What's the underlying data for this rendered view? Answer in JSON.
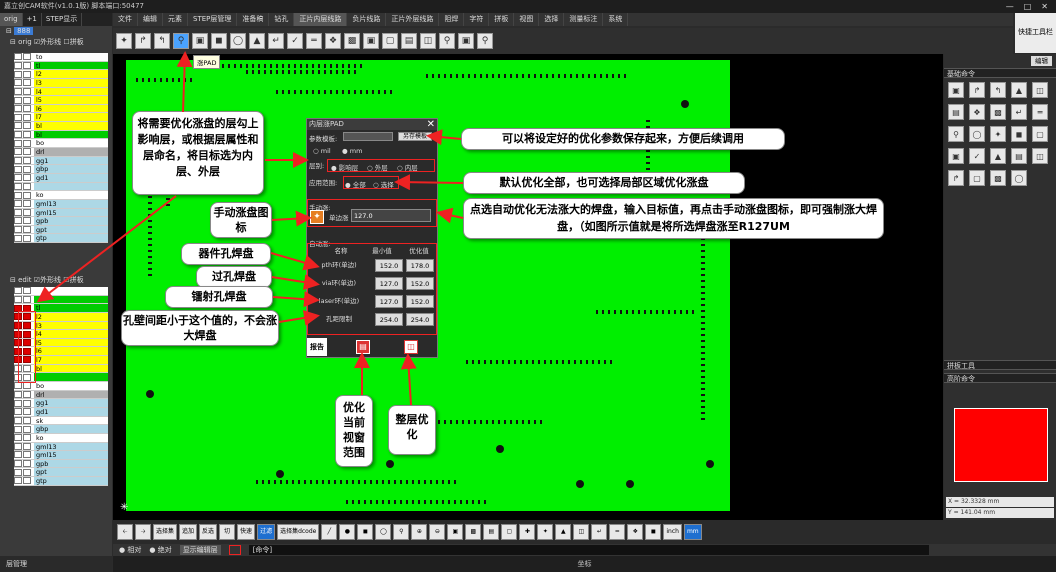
{
  "window": {
    "title": "嘉立创CAM软件(v1.0.1版) 脚本端口:50477"
  },
  "left": {
    "tabs": [
      "orig",
      "+1",
      "STEP显示"
    ],
    "job": "888",
    "orig_group": {
      "name": "orig",
      "opt1": "外形线",
      "opt2": "拼板"
    },
    "edit_group": {
      "name": "edit",
      "opt1": "外形线",
      "opt2": "拼板"
    },
    "orig_layers": [
      {
        "name": "to",
        "color": "#ffffff"
      },
      {
        "name": "tl",
        "color": "#00cc00"
      },
      {
        "name": "l2",
        "color": "#ffff00"
      },
      {
        "name": "l3",
        "color": "#ffff00"
      },
      {
        "name": "l4",
        "color": "#ffff00"
      },
      {
        "name": "l5",
        "color": "#ffff00"
      },
      {
        "name": "l6",
        "color": "#ffff00"
      },
      {
        "name": "l7",
        "color": "#ffff00"
      },
      {
        "name": "bl",
        "color": "#ffff00"
      },
      {
        "name": "bl",
        "color": "#00cc00"
      },
      {
        "name": "bo",
        "color": "#ffffff"
      },
      {
        "name": "drl",
        "color": "#b0b0b0"
      },
      {
        "name": "gg1",
        "color": "#add8e6"
      },
      {
        "name": "gbp",
        "color": "#add8e6"
      },
      {
        "name": "gd1",
        "color": "#add8e6"
      },
      {
        "name": "",
        "color": "#add8e6"
      },
      {
        "name": "ko",
        "color": "#ffffff"
      },
      {
        "name": "gml13",
        "color": "#add8e6"
      },
      {
        "name": "gml15",
        "color": "#add8e6"
      },
      {
        "name": "gpb",
        "color": "#add8e6"
      },
      {
        "name": "gpt",
        "color": "#add8e6"
      },
      {
        "name": "gtp",
        "color": "#add8e6"
      }
    ],
    "edit_layers": [
      {
        "name": "",
        "color": "#ffffff",
        "red": false
      },
      {
        "name": "",
        "color": "#00cc00",
        "red": false
      },
      {
        "name": "tl",
        "color": "#00cc00",
        "red": true
      },
      {
        "name": "l2",
        "color": "#ffff00",
        "red": true
      },
      {
        "name": "l3",
        "color": "#ffff00",
        "red": true
      },
      {
        "name": "l4",
        "color": "#ffff00",
        "red": true
      },
      {
        "name": "l5",
        "color": "#ffff00",
        "red": true
      },
      {
        "name": "l6",
        "color": "#ffff00",
        "red": true
      },
      {
        "name": "l7",
        "color": "#ffff00",
        "red": true
      },
      {
        "name": "bl",
        "color": "#ffff00",
        "red": false
      },
      {
        "name": "",
        "color": "#00cc00",
        "red": false
      },
      {
        "name": "bo",
        "color": "#ffffff",
        "red": false
      },
      {
        "name": "drl",
        "color": "#b0b0b0",
        "red": false
      },
      {
        "name": "gg1",
        "color": "#add8e6",
        "red": false
      },
      {
        "name": "gd1",
        "color": "#add8e6",
        "red": false
      },
      {
        "name": "sk",
        "color": "#ffffff",
        "red": false
      },
      {
        "name": "gbp",
        "color": "#add8e6",
        "red": false
      },
      {
        "name": "ko",
        "color": "#ffffff",
        "red": false
      },
      {
        "name": "gml13",
        "color": "#add8e6",
        "red": false
      },
      {
        "name": "gml15",
        "color": "#add8e6",
        "red": false
      },
      {
        "name": "gpb",
        "color": "#add8e6",
        "red": false
      },
      {
        "name": "gpt",
        "color": "#add8e6",
        "red": false
      },
      {
        "name": "gtp",
        "color": "#add8e6",
        "red": false
      }
    ],
    "footer": "层管理"
  },
  "menu": [
    "文件",
    "编辑",
    "元素",
    "STEP层管理",
    "准备稿",
    "钻孔",
    "正片内层线路",
    "负片线路",
    "正片外层线路",
    "阻焊",
    "字符",
    "拼板",
    "视图",
    "选择",
    "测量标注",
    "系统"
  ],
  "menu_active": 6,
  "quick_tools": "快捷工具栏",
  "tooltip": "涨PAD",
  "dialog": {
    "title": "内层涨PAD",
    "param_label": "参数模板:",
    "save_btn": "另存模板",
    "unit_mil": "mil",
    "unit_mm": "mm",
    "layer_label": "层别:",
    "layer_opts": [
      "影响层",
      "外层",
      "内层"
    ],
    "range_label": "应用范围:",
    "range_opts": [
      "全部",
      "选择"
    ],
    "manual_label": "手动涨:",
    "single_label": "单边涨",
    "single_value": "127.0",
    "auto_label": "自动涨:",
    "col_name": "名称",
    "col_min": "最小值",
    "col_opt": "优化值",
    "rows": [
      {
        "name": "pth环(单边)",
        "min": "152.0",
        "opt": "178.0"
      },
      {
        "name": "via环(单边)",
        "min": "127.0",
        "opt": "152.0"
      },
      {
        "name": "laser环(单边)",
        "min": "127.0",
        "opt": "152.0"
      },
      {
        "name": "孔距限制",
        "min": "254.0",
        "opt": "254.0"
      }
    ],
    "report": "报告"
  },
  "callouts": {
    "layers": "将需要优化涨盘的层勾上影响层，或根据层属性和层命名，将目标选为内层、外层",
    "save": "可以将设定好的优化参数保存起来，方便后续调用",
    "range": "默认优化全部，也可选择局部区域优化涨盘",
    "manual_icon": "手动涨盘图标",
    "manual_desc": "点选自动优化无法涨大的焊盘，输入目标值，再点击手动涨盘图标，即可强制涨大焊盘，（如图所示值就是将所选焊盘涨至R127UM",
    "pth": "器件孔焊盘",
    "via": "过孔焊盘",
    "laser": "镭射孔焊盘",
    "spacing": "孔壁间距小于这个值的，不会涨大焊盘",
    "view": "优化当前视窗范围",
    "whole": "整层优化"
  },
  "right": {
    "edit_tab": "编辑",
    "basic": "基础命令",
    "panel_tools": "拼板工具",
    "advanced": "高阶命令",
    "x": "X = 32.3328 mm",
    "y": "Y = 141.04 mm"
  },
  "bottom": {
    "buttons": [
      "选择集",
      "追加",
      "反选",
      "切",
      "快速",
      "过滤",
      "选择集dcode"
    ],
    "inch": "inch",
    "mm": "mm",
    "radio1": "相对",
    "radio2": "绝对",
    "display_edit": "显示编辑层",
    "command": "[命令]",
    "coord": "坐标"
  },
  "colors": {
    "board": "#00ef00",
    "accent": "#e22222",
    "select": "#4aa3ff"
  }
}
